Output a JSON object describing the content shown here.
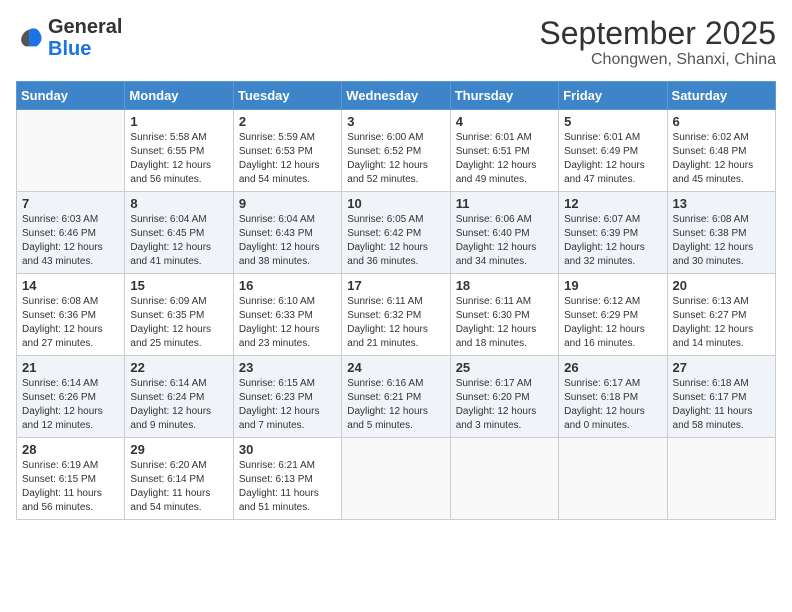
{
  "header": {
    "logo_general": "General",
    "logo_blue": "Blue",
    "month_title": "September 2025",
    "location": "Chongwen, Shanxi, China"
  },
  "weekdays": [
    "Sunday",
    "Monday",
    "Tuesday",
    "Wednesday",
    "Thursday",
    "Friday",
    "Saturday"
  ],
  "weeks": [
    [
      {
        "day": "",
        "info": ""
      },
      {
        "day": "1",
        "info": "Sunrise: 5:58 AM\nSunset: 6:55 PM\nDaylight: 12 hours\nand 56 minutes."
      },
      {
        "day": "2",
        "info": "Sunrise: 5:59 AM\nSunset: 6:53 PM\nDaylight: 12 hours\nand 54 minutes."
      },
      {
        "day": "3",
        "info": "Sunrise: 6:00 AM\nSunset: 6:52 PM\nDaylight: 12 hours\nand 52 minutes."
      },
      {
        "day": "4",
        "info": "Sunrise: 6:01 AM\nSunset: 6:51 PM\nDaylight: 12 hours\nand 49 minutes."
      },
      {
        "day": "5",
        "info": "Sunrise: 6:01 AM\nSunset: 6:49 PM\nDaylight: 12 hours\nand 47 minutes."
      },
      {
        "day": "6",
        "info": "Sunrise: 6:02 AM\nSunset: 6:48 PM\nDaylight: 12 hours\nand 45 minutes."
      }
    ],
    [
      {
        "day": "7",
        "info": "Sunrise: 6:03 AM\nSunset: 6:46 PM\nDaylight: 12 hours\nand 43 minutes."
      },
      {
        "day": "8",
        "info": "Sunrise: 6:04 AM\nSunset: 6:45 PM\nDaylight: 12 hours\nand 41 minutes."
      },
      {
        "day": "9",
        "info": "Sunrise: 6:04 AM\nSunset: 6:43 PM\nDaylight: 12 hours\nand 38 minutes."
      },
      {
        "day": "10",
        "info": "Sunrise: 6:05 AM\nSunset: 6:42 PM\nDaylight: 12 hours\nand 36 minutes."
      },
      {
        "day": "11",
        "info": "Sunrise: 6:06 AM\nSunset: 6:40 PM\nDaylight: 12 hours\nand 34 minutes."
      },
      {
        "day": "12",
        "info": "Sunrise: 6:07 AM\nSunset: 6:39 PM\nDaylight: 12 hours\nand 32 minutes."
      },
      {
        "day": "13",
        "info": "Sunrise: 6:08 AM\nSunset: 6:38 PM\nDaylight: 12 hours\nand 30 minutes."
      }
    ],
    [
      {
        "day": "14",
        "info": "Sunrise: 6:08 AM\nSunset: 6:36 PM\nDaylight: 12 hours\nand 27 minutes."
      },
      {
        "day": "15",
        "info": "Sunrise: 6:09 AM\nSunset: 6:35 PM\nDaylight: 12 hours\nand 25 minutes."
      },
      {
        "day": "16",
        "info": "Sunrise: 6:10 AM\nSunset: 6:33 PM\nDaylight: 12 hours\nand 23 minutes."
      },
      {
        "day": "17",
        "info": "Sunrise: 6:11 AM\nSunset: 6:32 PM\nDaylight: 12 hours\nand 21 minutes."
      },
      {
        "day": "18",
        "info": "Sunrise: 6:11 AM\nSunset: 6:30 PM\nDaylight: 12 hours\nand 18 minutes."
      },
      {
        "day": "19",
        "info": "Sunrise: 6:12 AM\nSunset: 6:29 PM\nDaylight: 12 hours\nand 16 minutes."
      },
      {
        "day": "20",
        "info": "Sunrise: 6:13 AM\nSunset: 6:27 PM\nDaylight: 12 hours\nand 14 minutes."
      }
    ],
    [
      {
        "day": "21",
        "info": "Sunrise: 6:14 AM\nSunset: 6:26 PM\nDaylight: 12 hours\nand 12 minutes."
      },
      {
        "day": "22",
        "info": "Sunrise: 6:14 AM\nSunset: 6:24 PM\nDaylight: 12 hours\nand 9 minutes."
      },
      {
        "day": "23",
        "info": "Sunrise: 6:15 AM\nSunset: 6:23 PM\nDaylight: 12 hours\nand 7 minutes."
      },
      {
        "day": "24",
        "info": "Sunrise: 6:16 AM\nSunset: 6:21 PM\nDaylight: 12 hours\nand 5 minutes."
      },
      {
        "day": "25",
        "info": "Sunrise: 6:17 AM\nSunset: 6:20 PM\nDaylight: 12 hours\nand 3 minutes."
      },
      {
        "day": "26",
        "info": "Sunrise: 6:17 AM\nSunset: 6:18 PM\nDaylight: 12 hours\nand 0 minutes."
      },
      {
        "day": "27",
        "info": "Sunrise: 6:18 AM\nSunset: 6:17 PM\nDaylight: 11 hours\nand 58 minutes."
      }
    ],
    [
      {
        "day": "28",
        "info": "Sunrise: 6:19 AM\nSunset: 6:15 PM\nDaylight: 11 hours\nand 56 minutes."
      },
      {
        "day": "29",
        "info": "Sunrise: 6:20 AM\nSunset: 6:14 PM\nDaylight: 11 hours\nand 54 minutes."
      },
      {
        "day": "30",
        "info": "Sunrise: 6:21 AM\nSunset: 6:13 PM\nDaylight: 11 hours\nand 51 minutes."
      },
      {
        "day": "",
        "info": ""
      },
      {
        "day": "",
        "info": ""
      },
      {
        "day": "",
        "info": ""
      },
      {
        "day": "",
        "info": ""
      }
    ]
  ]
}
